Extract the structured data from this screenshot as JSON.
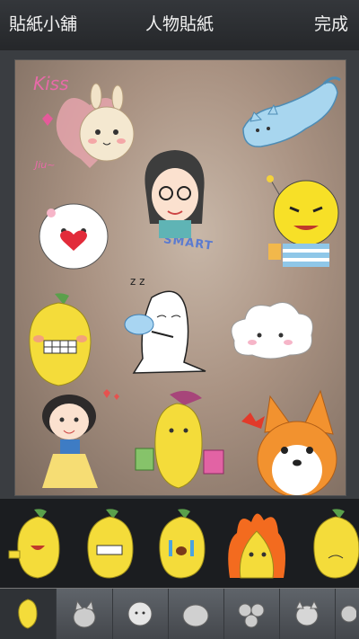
{
  "header": {
    "left_label": "貼紙小舖",
    "title": "人物貼紙",
    "right_label": "完成"
  },
  "canvas": {
    "sticker_texts": {
      "kiss": "Kiss",
      "jiu": "Jiu~",
      "smart": "SMART"
    }
  },
  "tray": {
    "items": [
      "banana-wave-sticker",
      "banana-grin-sticker",
      "banana-cry-sticker",
      "banana-fire-sticker",
      "banana-sad-sticker"
    ]
  },
  "tabs": {
    "items": [
      "banana-tab",
      "cat-tab",
      "sheep-tab",
      "seal-tab",
      "group-tab",
      "dog-tab",
      "more-tab"
    ],
    "active_index": 0
  },
  "colors": {
    "header_bg": "#2b2d30",
    "tray_bg": "#1b1d20",
    "tab_bar_bg": "#54585e",
    "banana_yellow": "#f4dc3a"
  }
}
